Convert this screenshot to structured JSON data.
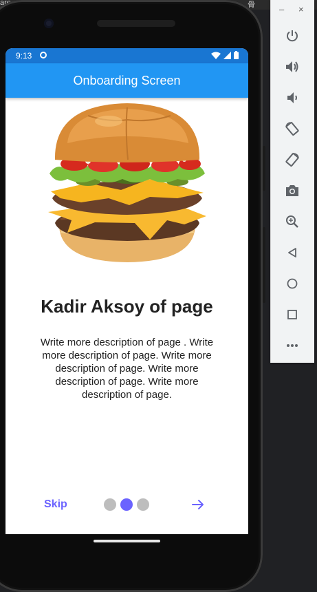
{
  "window": {
    "title_fragment_left": "are",
    "title_fragment_right": "骨"
  },
  "phone": {
    "status_bar": {
      "time": "9:13"
    },
    "app_bar": {
      "title": "Onboarding Screen"
    },
    "onboarding": {
      "image": "burger-image",
      "title": "Kadir Aksoy of page",
      "description": "Write more description of page . Write more description of page. Write more description of page. Write more description of page. Write more description of page.",
      "skip_label": "Skip",
      "page_indicator": {
        "count": 3,
        "active_index": 1
      },
      "next_icon": "arrow-right-icon"
    }
  },
  "emulator_toolbar": {
    "minimize_label": "–",
    "close_label": "×",
    "buttons": [
      "power-icon",
      "volume-up-icon",
      "volume-down-icon",
      "rotate-left-icon",
      "rotate-right-icon",
      "camera-icon",
      "zoom-icon",
      "back-icon",
      "home-icon",
      "overview-icon",
      "more-icon"
    ]
  },
  "colors": {
    "status_bar": "#1976d2",
    "app_bar": "#2196f3",
    "accent": "#6b63ff",
    "dot_inactive": "#bdbdbd"
  }
}
